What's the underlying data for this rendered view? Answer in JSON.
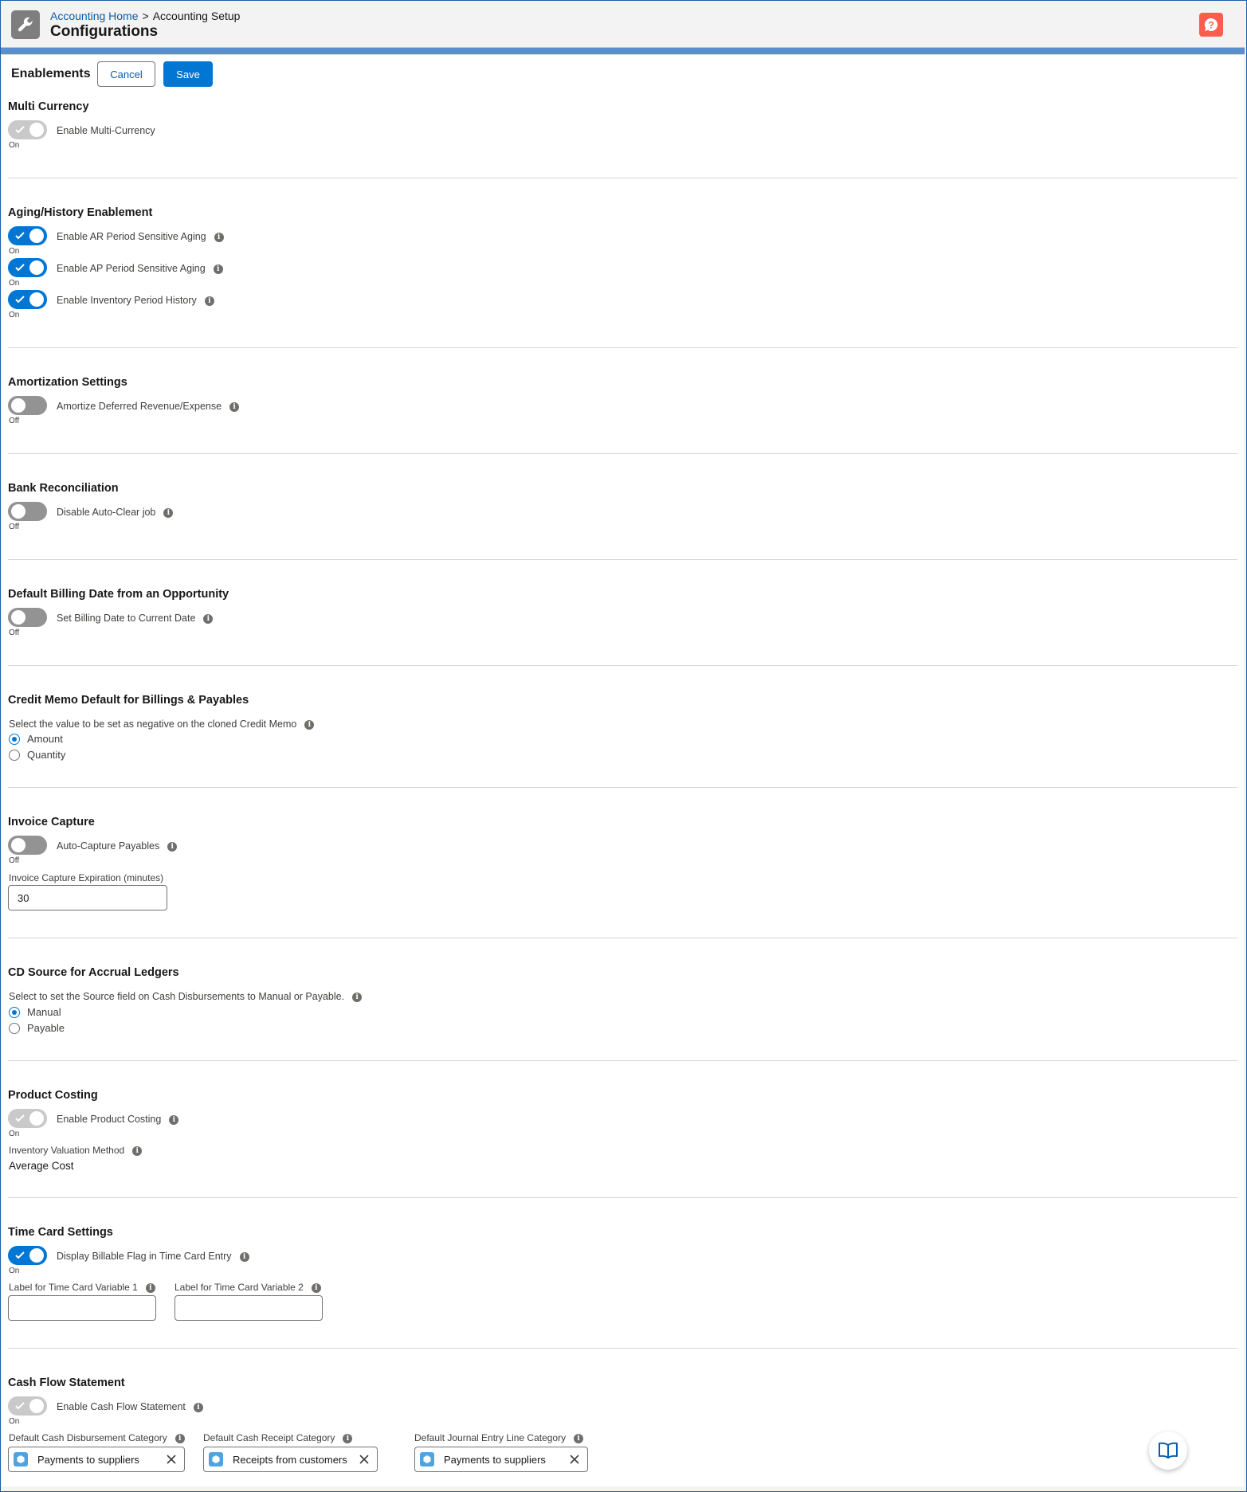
{
  "header": {
    "breadcrumb_home": "Accounting Home",
    "breadcrumb_separator": ">",
    "breadcrumb_current": "Accounting Setup",
    "title": "Configurations",
    "app_icon": "wrench-icon",
    "help_icon": "help-icon"
  },
  "toolbar": {
    "title": "Enablements",
    "cancel_label": "Cancel",
    "save_label": "Save"
  },
  "multi_currency": {
    "title": "Multi Currency",
    "enable_label": "Enable Multi-Currency",
    "enable_state": "On"
  },
  "aging": {
    "title": "Aging/History Enablement",
    "ar_label": "Enable AR Period Sensitive Aging",
    "ar_state": "On",
    "ap_label": "Enable AP Period Sensitive Aging",
    "ap_state": "On",
    "inv_label": "Enable Inventory Period History",
    "inv_state": "On"
  },
  "amortization": {
    "title": "Amortization Settings",
    "label": "Amortize Deferred Revenue/Expense",
    "state": "Off"
  },
  "bank": {
    "title": "Bank Reconciliation",
    "label": "Disable Auto-Clear job",
    "state": "Off"
  },
  "billing_date": {
    "title": "Default Billing Date from an Opportunity",
    "label": "Set Billing Date to Current Date",
    "state": "Off"
  },
  "credit_memo": {
    "title": "Credit Memo Default for Billings & Payables",
    "description": "Select the value to be set as negative on the cloned Credit Memo",
    "option_amount": "Amount",
    "option_quantity": "Quantity",
    "selected": "Amount"
  },
  "invoice_capture": {
    "title": "Invoice Capture",
    "label": "Auto-Capture Payables",
    "state": "Off",
    "expiration_label": "Invoice Capture Expiration (minutes)",
    "expiration_value": "30"
  },
  "cd_source": {
    "title": "CD Source for Accrual Ledgers",
    "description": "Select to set the Source field on Cash Disbursements to Manual or Payable.",
    "option_manual": "Manual",
    "option_payable": "Payable",
    "selected": "Manual"
  },
  "product_costing": {
    "title": "Product Costing",
    "label": "Enable Product Costing",
    "state": "On",
    "valuation_label": "Inventory Valuation Method",
    "valuation_value": "Average Cost"
  },
  "time_card": {
    "title": "Time Card Settings",
    "label": "Display Billable Flag in Time Card Entry",
    "state": "On",
    "var1_label": "Label for Time Card Variable 1",
    "var1_value": "",
    "var2_label": "Label for Time Card Variable 2",
    "var2_value": ""
  },
  "cash_flow": {
    "title": "Cash Flow Statement",
    "label": "Enable Cash Flow Statement",
    "state": "On",
    "disb_label": "Default Cash Disbursement Category",
    "disb_value": "Payments to suppliers",
    "receipt_label": "Default Cash Receipt Category",
    "receipt_value": "Receipts from customers",
    "journal_label": "Default Journal Entry Line Category",
    "journal_value": "Payments to suppliers"
  },
  "colors": {
    "brand_blue": "#0176d3",
    "help_orange": "#fe5c4c",
    "toggle_off": "#939393",
    "toggle_disabled": "#c9c9c9"
  },
  "info_glyph": "i"
}
